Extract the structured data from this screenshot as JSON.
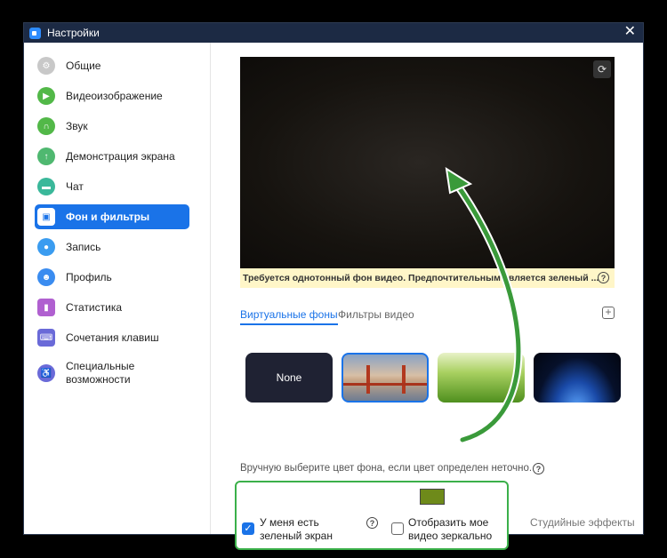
{
  "window": {
    "title": "Настройки",
    "close_glyph": "✕"
  },
  "sidebar": {
    "items": [
      {
        "label": "Общие",
        "icon": "gear-icon",
        "color": "#c8c8c8",
        "active": false
      },
      {
        "label": "Видеоизображение",
        "icon": "video-icon",
        "color": "#52b848",
        "active": false
      },
      {
        "label": "Звук",
        "icon": "headphones-icon",
        "color": "#52b848",
        "active": false
      },
      {
        "label": "Демонстрация экрана",
        "icon": "share-screen-icon",
        "color": "#4fb870",
        "active": false
      },
      {
        "label": "Чат",
        "icon": "chat-icon",
        "color": "#3ab89a",
        "active": false
      },
      {
        "label": "Фон и фильтры",
        "icon": "background-icon",
        "color": "#ffffff",
        "active": true
      },
      {
        "label": "Запись",
        "icon": "record-icon",
        "color": "#3a9cf0",
        "active": false
      },
      {
        "label": "Профиль",
        "icon": "profile-icon",
        "color": "#3a8cf0",
        "active": false
      },
      {
        "label": "Статистика",
        "icon": "statistics-icon",
        "color": "#b060d0",
        "active": false
      },
      {
        "label": "Сочетания клавиш",
        "icon": "keyboard-icon",
        "color": "#6a6ad8",
        "active": false
      },
      {
        "label": "Специальные возможности",
        "icon": "accessibility-icon",
        "color": "#6a6ad8",
        "active": false
      }
    ]
  },
  "main": {
    "notice": "Требуется однотонный фон видео. Предпочтительным является зеленый ...",
    "tabs": [
      {
        "label": "Виртуальные фоны",
        "active": true
      },
      {
        "label": "Фильтры видео",
        "active": false
      }
    ],
    "backgrounds": [
      {
        "label": "None",
        "name": "none"
      },
      {
        "label": "",
        "name": "golden-gate-bridge"
      },
      {
        "label": "",
        "name": "grass"
      },
      {
        "label": "",
        "name": "earth-from-space"
      }
    ],
    "manual_color_text": "Вручную выберите цвет фона, если цвет определен неточно.",
    "green_screen_label": "У меня есть зеленый экран",
    "mirror_label": "Отобразить мое видео зеркально",
    "studio_effects": "Студийные эффекты",
    "selected_color": "#6e8a1a",
    "green_screen_checked": true,
    "mirror_checked": false
  },
  "colors": {
    "accent": "#1a73e8",
    "highlight_frame": "#3bb04a",
    "notice_bg": "#fff6c8"
  }
}
